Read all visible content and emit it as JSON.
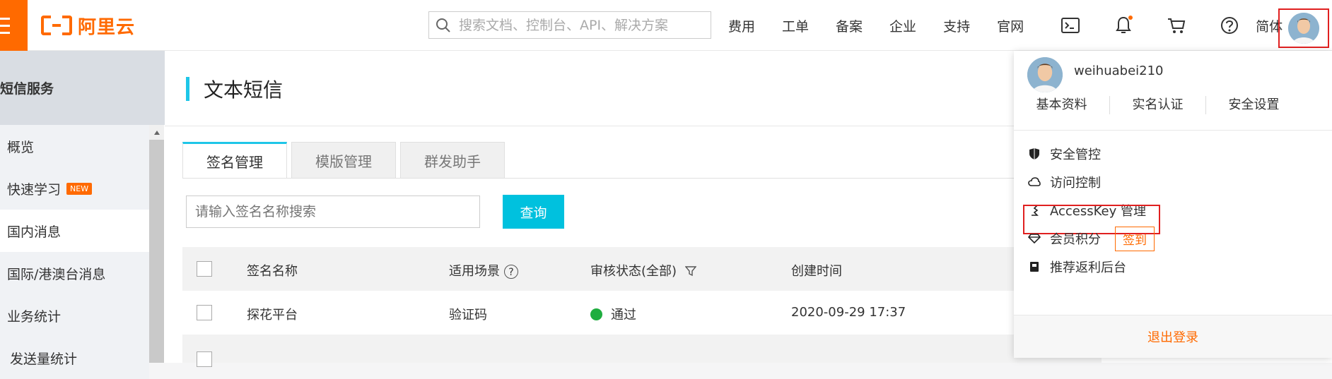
{
  "brand": {
    "name": "阿里云",
    "accent": "#ff6a00"
  },
  "search": {
    "placeholder": "搜索文档、控制台、API、解决方案"
  },
  "nav": {
    "links": [
      "费用",
      "工单",
      "备案",
      "企业",
      "支持",
      "官网"
    ],
    "icons": [
      "terminal-icon",
      "bell-icon",
      "cart-icon",
      "help-icon"
    ],
    "lang": "简体"
  },
  "sidebar": {
    "title": "短信服务",
    "items": [
      {
        "label": "概览"
      },
      {
        "label": "快速学习",
        "badge": "NEW"
      },
      {
        "label": "国内消息"
      },
      {
        "label": "国际/港澳台消息"
      },
      {
        "label": "业务统计"
      },
      {
        "label": "发送量统计"
      }
    ]
  },
  "page": {
    "title": "文本短信"
  },
  "tabs": [
    "签名管理",
    "模版管理",
    "群发助手"
  ],
  "filter": {
    "placeholder": "请输入签名名称搜索",
    "button": "查询"
  },
  "table": {
    "headers": [
      "签名名称",
      "适用场景",
      "审核状态(全部)",
      "创建时间"
    ],
    "rows": [
      {
        "name": "探花平台",
        "scene": "验证码",
        "status": "通过",
        "created": "2020-09-29 17:37"
      }
    ]
  },
  "account_menu": {
    "username": "weihuabei210",
    "quick_links": [
      "基本资料",
      "实名认证",
      "安全设置"
    ],
    "items": [
      "安全管控",
      "访问控制",
      "AccessKey 管理",
      "会员积分",
      "推荐返利后台"
    ],
    "checkin": "签到",
    "logout": "退出登录"
  }
}
